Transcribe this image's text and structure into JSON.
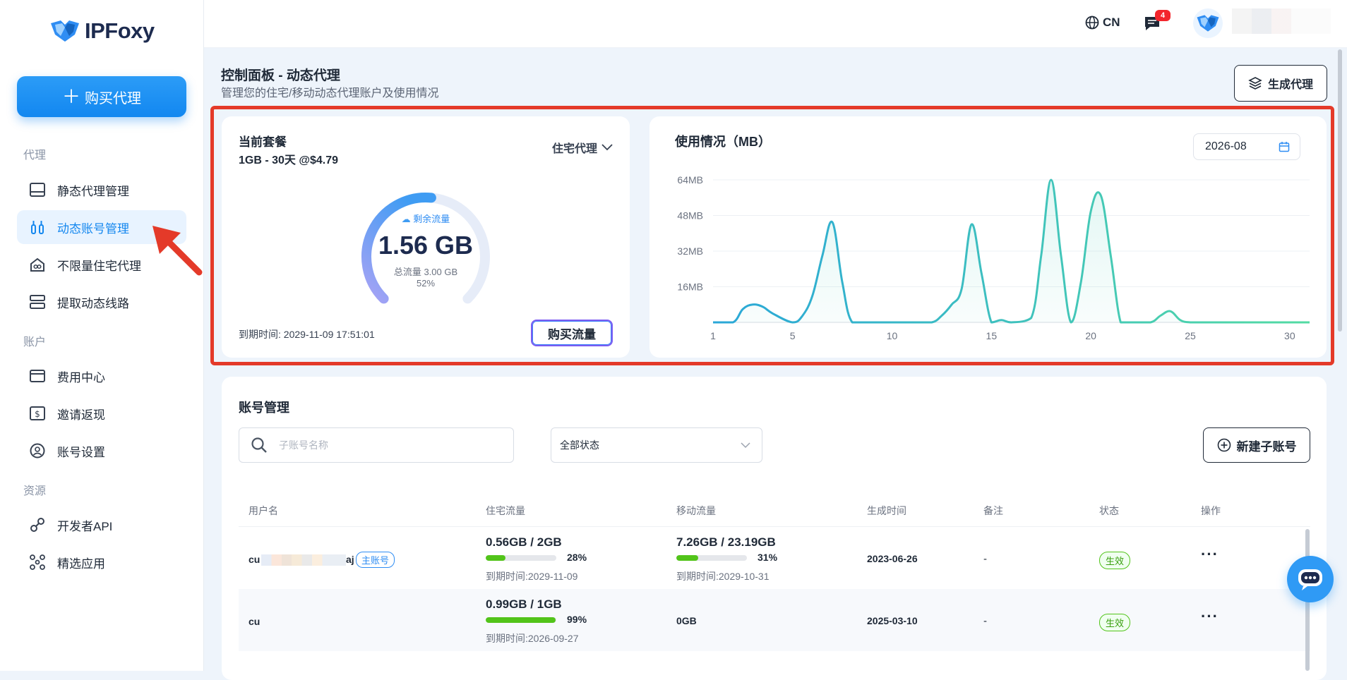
{
  "brand": {
    "name": "IPFoxy"
  },
  "sidebar": {
    "buy_label": "购买代理",
    "sections": [
      {
        "label": "代理",
        "items": [
          {
            "label": "静态代理管理",
            "icon": "server-icon"
          },
          {
            "label": "动态账号管理",
            "icon": "dynamic-proxy-icon",
            "active": true
          },
          {
            "label": "不限量住宅代理",
            "icon": "infinity-home-icon"
          },
          {
            "label": "提取动态线路",
            "icon": "lines-icon"
          }
        ]
      },
      {
        "label": "账户",
        "items": [
          {
            "label": "费用中心",
            "icon": "card-icon"
          },
          {
            "label": "邀请返现",
            "icon": "dollar-icon"
          },
          {
            "label": "账号设置",
            "icon": "user-circle-icon"
          }
        ]
      },
      {
        "label": "资源",
        "items": [
          {
            "label": "开发者API",
            "icon": "plug-icon"
          },
          {
            "label": "精选应用",
            "icon": "apps-icon"
          }
        ]
      }
    ]
  },
  "header": {
    "lang": "CN",
    "message_count": "4"
  },
  "page": {
    "title": "控制面板 - 动态代理",
    "subtitle": "管理您的住宅/移动动态代理账户及使用情况",
    "generate_label": "生成代理"
  },
  "plan": {
    "title": "当前套餐",
    "name": "1GB - 30天 @$4.79",
    "type": "住宅代理",
    "remaining_label": "剩余流量",
    "remaining_value": "1.56 GB",
    "total_label": "总流量 3.00 GB",
    "percent_label": "52%",
    "percent": 52,
    "expire": "到期时间: 2029-11-09 17:51:01",
    "buy_flow_label": "购买流量"
  },
  "usage": {
    "title": "使用情况（MB）",
    "date": "2026-08"
  },
  "chart_data": {
    "type": "area",
    "title": "使用情况（MB）",
    "ylabels": [
      "64MB",
      "48MB",
      "32MB",
      "16MB"
    ],
    "yticks": [
      64,
      48,
      32,
      16
    ],
    "ylim": [
      0,
      64
    ],
    "xticks": [
      1,
      5,
      10,
      15,
      20,
      25,
      30
    ],
    "xlim": [
      1,
      31
    ],
    "x": [
      1,
      2,
      2.5,
      3,
      3.5,
      4,
      5,
      5.5,
      6,
      6.5,
      7,
      7.5,
      8,
      9,
      10,
      11,
      12,
      12.5,
      13,
      13.5,
      14,
      14.5,
      15,
      15.5,
      16,
      17,
      17.5,
      18,
      18.5,
      19,
      19.5,
      20,
      20.5,
      21,
      21.5,
      22,
      23,
      23.5,
      24,
      24.5,
      25,
      26,
      28,
      30,
      31
    ],
    "values": [
      0,
      0,
      6,
      8,
      7,
      4,
      0,
      3,
      12,
      30,
      45,
      18,
      0,
      0,
      0,
      0,
      0,
      3,
      8,
      15,
      44,
      22,
      0,
      1,
      0,
      2,
      30,
      64,
      30,
      0,
      18,
      50,
      57,
      30,
      0,
      0,
      0,
      3,
      5,
      1,
      0,
      0,
      0,
      0,
      0
    ],
    "grid": true
  },
  "accounts": {
    "title": "账号管理",
    "search_placeholder": "子账号名称",
    "status_filter": "全部状态",
    "new_sub_label": "新建子账号",
    "columns": [
      "用户名",
      "住宅流量",
      "移动流量",
      "生成时间",
      "备注",
      "状态",
      "操作"
    ],
    "rows": [
      {
        "username_prefix": "cu",
        "username_suffix": "aj",
        "tag": "主账号",
        "res_usage": "0.56GB / 2GB",
        "res_pct": "28%",
        "res_pct_num": 28,
        "res_expire": "到期时间:2029-11-09",
        "mob_usage": "7.26GB / 23.19GB",
        "mob_pct": "31%",
        "mob_pct_num": 31,
        "mob_expire": "到期时间:2029-10-31",
        "created": "2023-06-26",
        "note": "-",
        "status": "生效",
        "ops": "···"
      },
      {
        "username_prefix": "cu",
        "res_usage": "0.99GB / 1GB",
        "res_pct": "99%",
        "res_pct_num": 99,
        "res_expire": "到期时间:2026-09-27",
        "mob_usage": "0GB",
        "created": "2025-03-10",
        "note": "-",
        "status": "生效",
        "ops": "···"
      }
    ]
  }
}
